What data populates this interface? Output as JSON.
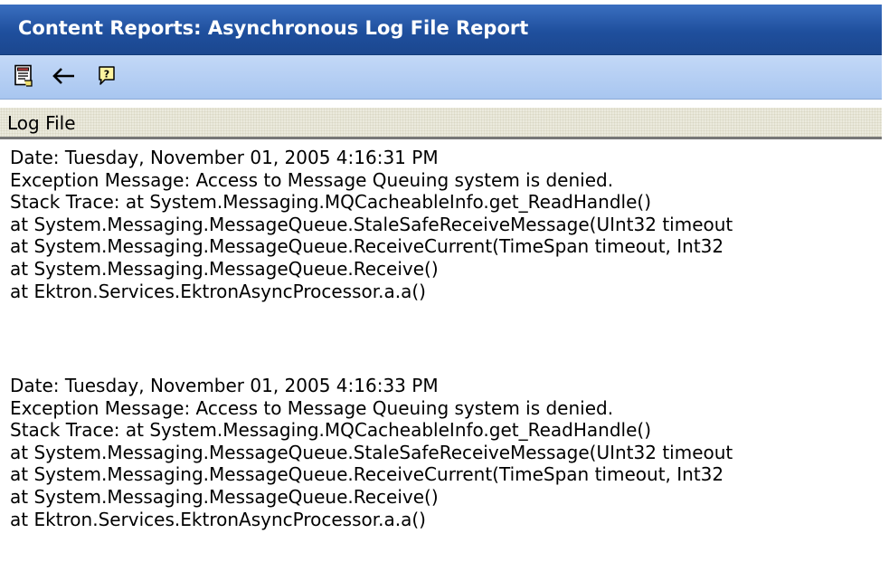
{
  "window": {
    "title": "Content Reports: Asynchronous Log File Report"
  },
  "toolbar": {
    "buttons": [
      {
        "icon": "view-report-icon",
        "label": ""
      },
      {
        "icon": "back-arrow-icon",
        "label": "←"
      },
      {
        "icon": "help-icon",
        "label": ""
      }
    ]
  },
  "section": {
    "title": "Log File"
  },
  "log_entries": [
    {
      "date": "Date: Tuesday, November 01, 2005 4:16:31 PM",
      "exception": "Exception Message: Access to Message Queuing system is denied.",
      "stack_trace": [
        "Stack Trace: at System.Messaging.MQCacheableInfo.get_ReadHandle()",
        "at System.Messaging.MessageQueue.StaleSafeReceiveMessage(UInt32 timeout",
        "at System.Messaging.MessageQueue.ReceiveCurrent(TimeSpan timeout, Int32",
        "at System.Messaging.MessageQueue.Receive()",
        "at Ektron.Services.EktronAsyncProcessor.a.a()"
      ]
    },
    {
      "date": "Date: Tuesday, November 01, 2005 4:16:33 PM",
      "exception": "Exception Message: Access to Message Queuing system is denied.",
      "stack_trace": [
        "Stack Trace: at System.Messaging.MQCacheableInfo.get_ReadHandle()",
        "at System.Messaging.MessageQueue.StaleSafeReceiveMessage(UInt32 timeout",
        "at System.Messaging.MessageQueue.ReceiveCurrent(TimeSpan timeout, Int32",
        "at System.Messaging.MessageQueue.Receive()",
        "at Ektron.Services.EktronAsyncProcessor.a.a()"
      ]
    }
  ],
  "colors": {
    "title_bar": "#1f4f9d",
    "title_text": "#ffffff",
    "toolbar": "#b5cff3",
    "section_header": "#ebeadd",
    "section_border": "#777777"
  }
}
